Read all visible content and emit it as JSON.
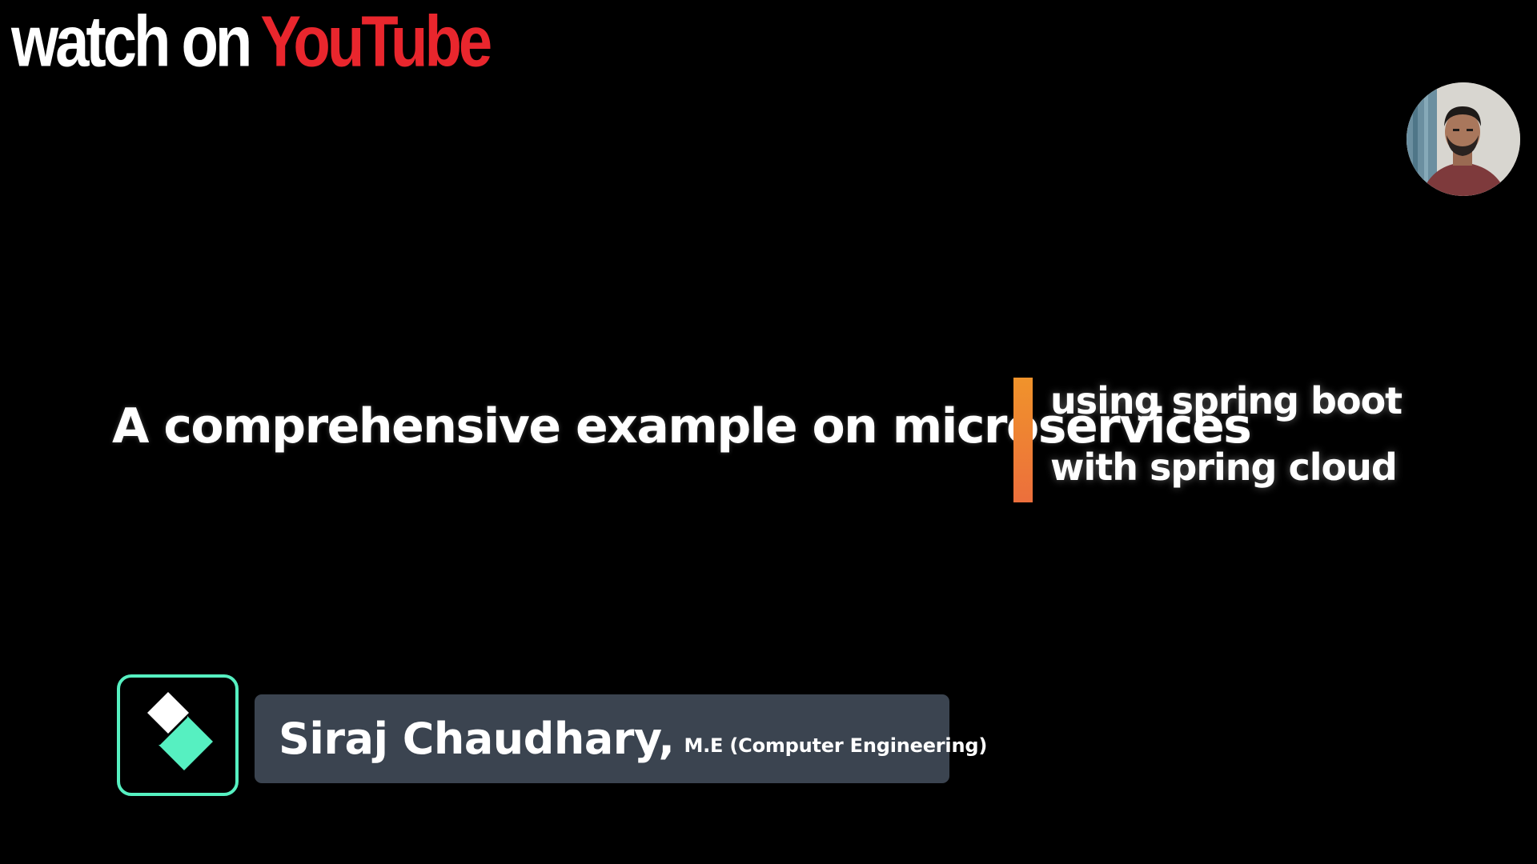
{
  "watermark": {
    "prefix": "watch on",
    "brand": "YouTube",
    "prefix_color": "#ffffff",
    "brand_color": "#e9262d"
  },
  "webcam": {
    "icon": "webcam-avatar"
  },
  "title": {
    "main": "A comprehensive example on microservices",
    "sub_line1": "using spring boot",
    "sub_line2": "with spring cloud",
    "accent_color": "#f0932b"
  },
  "lower_third": {
    "logo_icon": "filmora-logo-icon",
    "logo_color": "#56f0c1",
    "name": "Siraj Chaudhary,",
    "credential": "M.E (Computer Engineering)",
    "plate_color": "#3b4450"
  }
}
